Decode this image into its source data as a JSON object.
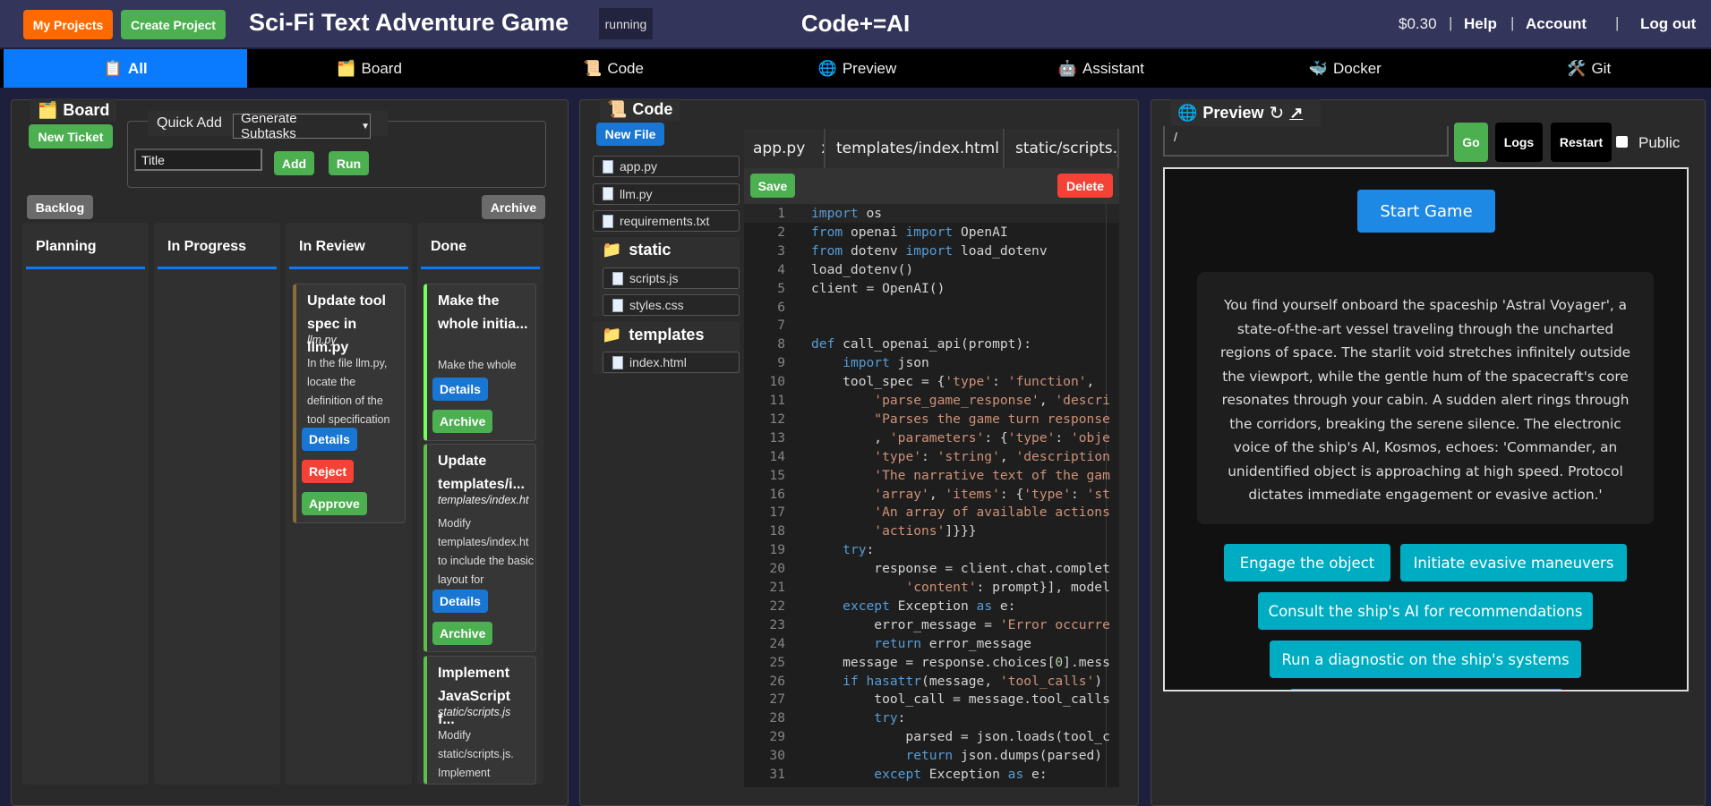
{
  "header": {
    "my_projects": "My Projects",
    "create_project": "Create Project",
    "project_title": "Sci-Fi Text Adventure Game",
    "status": "running",
    "brand": "Code+=AI",
    "cost": "$0.30",
    "sep": "|",
    "help": "Help",
    "account": "Account",
    "logout": "Log out",
    "colors": {
      "my_projects": "#ff6a00",
      "create_project": "#4caf50"
    }
  },
  "nav": {
    "tabs": [
      {
        "icon": "📋",
        "label": "All",
        "active": true
      },
      {
        "icon": "🗂️",
        "label": "Board"
      },
      {
        "icon": "📜",
        "label": "Code"
      },
      {
        "icon": "🌐",
        "label": "Preview"
      },
      {
        "icon": "🤖",
        "label": "Assistant"
      },
      {
        "icon": "🐳",
        "label": "Docker"
      },
      {
        "icon": "🛠️",
        "label": "Git"
      }
    ]
  },
  "board": {
    "icon": "🗂️",
    "title": "Board",
    "new_ticket": "New Ticket",
    "quick_add": {
      "legend": "Quick Add",
      "mode": "Generate Subtasks",
      "title_value": "Title",
      "add": "Add",
      "run": "Run"
    },
    "backlog": "Backlog",
    "archive": "Archive",
    "columns": [
      {
        "name": "Planning"
      },
      {
        "name": "In Progress"
      },
      {
        "name": "In Review"
      },
      {
        "name": "Done"
      }
    ],
    "review_cards": [
      {
        "title": "Update tool\nspec in llm.py",
        "file": "llm.py",
        "desc": "In the file llm.py, locate the definition of the tool specification",
        "buttons": [
          "Details",
          "Reject",
          "Approve"
        ]
      }
    ],
    "done_cards": [
      {
        "title": "Make the\nwhole initia...",
        "file": "",
        "desc": "Make the whole initial site",
        "buttons": [
          "Details",
          "Archive"
        ]
      },
      {
        "title": "Update\ntemplates/i...",
        "file": "templates/index.ht",
        "desc": "Modify templates/index.ht to include the basic layout for",
        "buttons": [
          "Details",
          "Archive"
        ]
      },
      {
        "title": "Implement\nJavaScript f...",
        "file": "static/scripts.js",
        "desc": "Modify static/scripts.js. Implement",
        "buttons": []
      }
    ]
  },
  "code": {
    "icon": "📜",
    "title": "Code",
    "new_file": "New File",
    "files": [
      "app.py",
      "llm.py",
      "requirements.txt"
    ],
    "folders": [
      {
        "name": "static",
        "files": [
          "scripts.js",
          "styles.css"
        ]
      },
      {
        "name": "templates",
        "files": [
          "index.html"
        ]
      }
    ],
    "tabs": [
      {
        "label": "app.py",
        "close": "x"
      },
      {
        "label": "templates/index.html",
        "close": "x"
      },
      {
        "label": "static/scripts.js",
        "close": ""
      }
    ],
    "save": "Save",
    "delete": "Delete",
    "lines": [
      [
        [
          "import",
          "k"
        ],
        [
          " os",
          ""
        ]
      ],
      [
        [
          "from",
          "k"
        ],
        [
          " openai ",
          ""
        ],
        [
          "import",
          "k"
        ],
        [
          " OpenAI",
          ""
        ]
      ],
      [
        [
          "from",
          "k"
        ],
        [
          " dotenv ",
          ""
        ],
        [
          "import",
          "k"
        ],
        [
          " load_dotenv",
          ""
        ]
      ],
      [
        [
          "load_dotenv()",
          ""
        ]
      ],
      [
        [
          "client = OpenAI()",
          ""
        ]
      ],
      [],
      [],
      [
        [
          "def",
          "k"
        ],
        [
          " call_openai_api(prompt):",
          ""
        ]
      ],
      [
        [
          "    ",
          ""
        ],
        [
          "import",
          "k"
        ],
        [
          " json",
          ""
        ]
      ],
      [
        [
          "    tool_spec = {",
          ""
        ],
        [
          "'type'",
          "s"
        ],
        [
          ": ",
          ""
        ],
        [
          "'function'",
          "s"
        ],
        [
          ", ",
          ""
        ]
      ],
      [
        [
          "        ",
          ""
        ],
        [
          "'parse_game_response'",
          "s"
        ],
        [
          ", ",
          ""
        ],
        [
          "'descri",
          "s"
        ]
      ],
      [
        [
          "        ",
          ""
        ],
        [
          "\"Parses the game turn response",
          "s"
        ]
      ],
      [
        [
          "        , ",
          ""
        ],
        [
          "'parameters'",
          "s"
        ],
        [
          ": {",
          ""
        ],
        [
          "'type'",
          "s"
        ],
        [
          ": ",
          ""
        ],
        [
          "'obje",
          "s"
        ]
      ],
      [
        [
          "        ",
          ""
        ],
        [
          "'type'",
          "s"
        ],
        [
          ": ",
          ""
        ],
        [
          "'string'",
          "s"
        ],
        [
          ", ",
          ""
        ],
        [
          "'description",
          "s"
        ]
      ],
      [
        [
          "        ",
          ""
        ],
        [
          "'The narrative text of the gam",
          "s"
        ]
      ],
      [
        [
          "        ",
          ""
        ],
        [
          "'array'",
          "s"
        ],
        [
          ", ",
          ""
        ],
        [
          "'items'",
          "s"
        ],
        [
          ": {",
          ""
        ],
        [
          "'type'",
          "s"
        ],
        [
          ": ",
          ""
        ],
        [
          "'st",
          "s"
        ]
      ],
      [
        [
          "        ",
          ""
        ],
        [
          "'An array of available actions",
          "s"
        ]
      ],
      [
        [
          "        ",
          ""
        ],
        [
          "'actions'",
          "s"
        ],
        [
          "]}}}",
          ""
        ]
      ],
      [
        [
          "    ",
          ""
        ],
        [
          "try",
          "k"
        ],
        [
          ":",
          ""
        ]
      ],
      [
        [
          "        response = client.chat.complet",
          ""
        ]
      ],
      [
        [
          "            ",
          ""
        ],
        [
          "'content'",
          "s"
        ],
        [
          ": prompt}], model",
          ""
        ]
      ],
      [
        [
          "    ",
          ""
        ],
        [
          "except",
          "k"
        ],
        [
          " Exception ",
          ""
        ],
        [
          "as",
          "k"
        ],
        [
          " e:",
          ""
        ]
      ],
      [
        [
          "        error_message = ",
          ""
        ],
        [
          "'Error occurre",
          "s"
        ]
      ],
      [
        [
          "        ",
          ""
        ],
        [
          "return",
          "k"
        ],
        [
          " error_message",
          ""
        ]
      ],
      [
        [
          "    message = response.choices[",
          ""
        ],
        [
          "0",
          "n"
        ],
        [
          "].mess",
          ""
        ]
      ],
      [
        [
          "    ",
          ""
        ],
        [
          "if",
          "k"
        ],
        [
          " ",
          ""
        ],
        [
          "hasattr",
          "k"
        ],
        [
          "(message, ",
          ""
        ],
        [
          "'tool_calls'",
          "s"
        ],
        [
          ")",
          ""
        ]
      ],
      [
        [
          "        tool_call = message.tool_calls",
          ""
        ]
      ],
      [
        [
          "        ",
          ""
        ],
        [
          "try",
          "k"
        ],
        [
          ":",
          ""
        ]
      ],
      [
        [
          "            parsed = json.loads(tool_c",
          ""
        ]
      ],
      [
        [
          "            ",
          ""
        ],
        [
          "return",
          "k"
        ],
        [
          " json.dumps(parsed)",
          ""
        ]
      ],
      [
        [
          "        ",
          ""
        ],
        [
          "except",
          "k"
        ],
        [
          " Exception ",
          ""
        ],
        [
          "as",
          "k"
        ],
        [
          " e:",
          ""
        ]
      ]
    ]
  },
  "preview": {
    "icon": "🌐",
    "title": "Preview",
    "reload_icon": "↻",
    "open_icon": "↗",
    "url": "/",
    "go": "Go",
    "logs": "Logs",
    "restart": "Restart",
    "public_label": "Public",
    "public_checked": false,
    "app": {
      "start": "Start Game",
      "story": "You find yourself onboard the spaceship 'Astral Voyager', a state-of-the-art vessel traveling through the uncharted regions of space. The starlit void stretches infinitely outside the viewport, while the gentle hum of the spacecraft's core resonates through your cabin. A sudden alert rings through the corridors, breaking the serene silence. The electronic voice of the ship's AI, Kosmos, echoes: 'Commander, an unidentified object is approaching at high speed. Protocol dictates immediate engagement or evasive action.'",
      "choices": [
        "Engage the object",
        "Initiate evasive maneuvers",
        "Consult the ship's AI for recommendations",
        "Run a diagnostic on the ship's systems"
      ]
    }
  }
}
